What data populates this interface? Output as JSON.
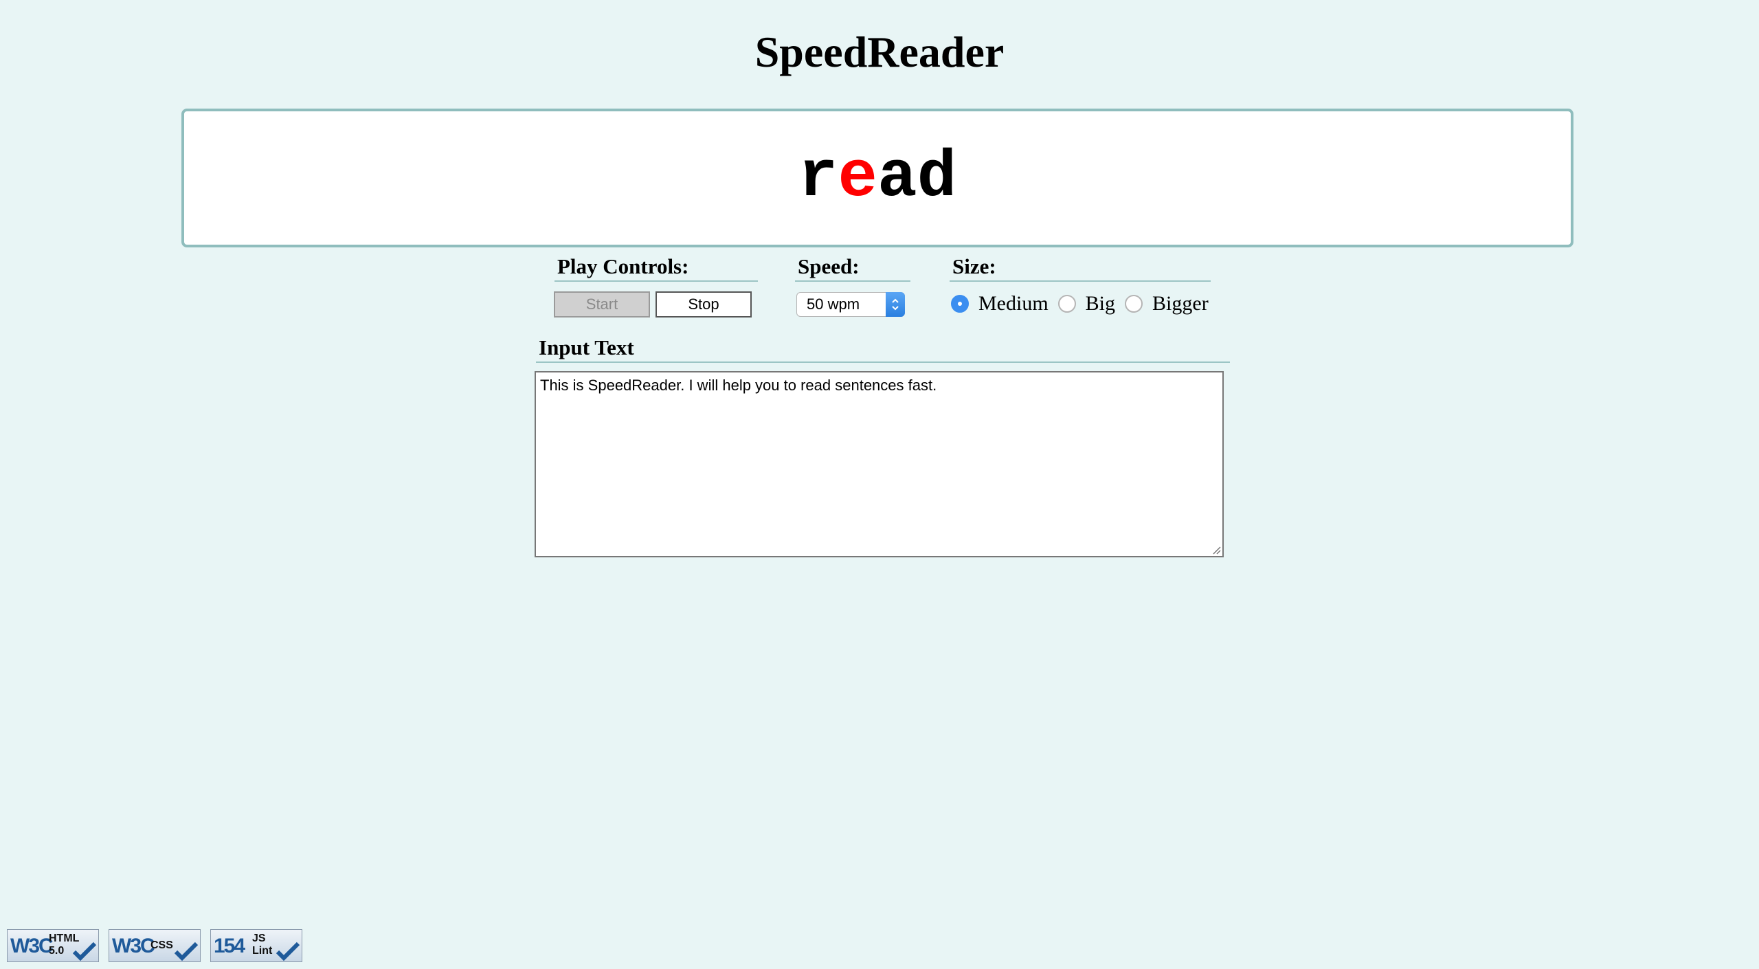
{
  "app": {
    "title": "SpeedReader"
  },
  "display": {
    "word_before": "r",
    "word_focus": "e",
    "word_after": "ad",
    "focus_color": "#ff0000"
  },
  "play_controls": {
    "title": "Play Controls:",
    "start_label": "Start",
    "stop_label": "Stop"
  },
  "speed": {
    "title": "Speed:",
    "selected": "50 wpm"
  },
  "size": {
    "title": "Size:",
    "options": [
      "Medium",
      "Big",
      "Bigger"
    ],
    "selected": "Medium"
  },
  "input": {
    "title": "Input Text",
    "value": "This is SpeedReader. I will help you to read sentences fast."
  },
  "badges": [
    {
      "main": "W3C",
      "sub": "HTML 5.0",
      "icon": "check-icon"
    },
    {
      "main": "W3C",
      "sub": "CSS",
      "icon": "check-icon"
    },
    {
      "main": "154",
      "sub": "JS Lint",
      "icon": "check-icon"
    }
  ],
  "colors": {
    "background": "#e8f5f5",
    "display_border": "#8fbdbd",
    "accent": "#3b8ef0"
  }
}
